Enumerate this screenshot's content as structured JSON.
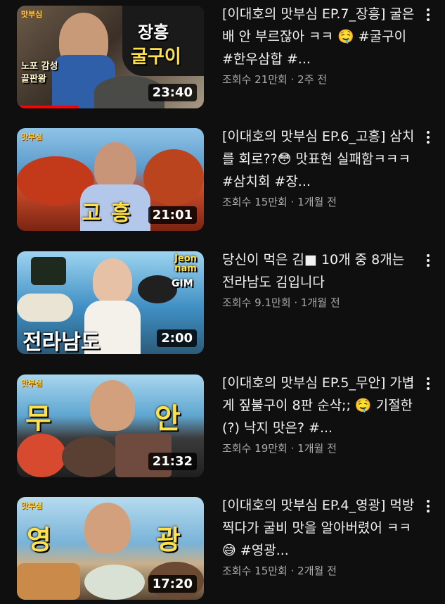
{
  "videos": [
    {
      "title": "[이대호의 맛부심 EP.7_장흥] 굴은 배 안 부르잖아 ㅋㅋ 🤤 #굴구이 #한우삼합 #...",
      "meta": "조회수 21만회 · 2주 전",
      "duration": "23:40",
      "watched_fraction": 0.33,
      "overlay_texts": [
        "맛부심",
        "장흥",
        "굴구이",
        "노포 감성 끝판왕"
      ]
    },
    {
      "title": "[이대호의 맛부심 EP.6_고흥] 삼치를 회로??😳 맛표현 실패함ㅋㅋㅋ  #삼치회 #장...",
      "meta": "조회수 15만회 · 1개월 전",
      "duration": "21:01",
      "overlay_texts": [
        "맛부심",
        "고 흥"
      ]
    },
    {
      "title": "당신이 먹은 김■ 10개 중 8개는 전라남도 김입니다",
      "meta": "조회수 9.1만회 · 1개월 전",
      "duration": "2:00",
      "overlay_texts": [
        "Jeon nam",
        "GIM",
        "전라남도"
      ]
    },
    {
      "title": "[이대호의 맛부심 EP.5_무안] 가볍게 짚불구이 8판 순삭;; 🤤 기절한(?) 낙지 맛은? #...",
      "meta": "조회수 19만회 · 1개월 전",
      "duration": "21:32",
      "overlay_texts": [
        "맛부심",
        "무",
        "안"
      ]
    },
    {
      "title": "[이대호의 맛부심 EP.4_영광] 먹방 찍다가 굴비 맛을 알아버렸어 ㅋㅋ 😅 #영광...",
      "meta": "조회수 15만회 · 2개월 전",
      "duration": "17:20",
      "overlay_texts": [
        "맛부심",
        "영",
        "광"
      ]
    }
  ],
  "colors": {
    "background": "#0f0f0f",
    "title_text": "#f1f1f1",
    "meta_text": "#aaaaaa",
    "progress_bar": "#ff0000"
  },
  "icons": {
    "menu": "more-vert-icon"
  }
}
